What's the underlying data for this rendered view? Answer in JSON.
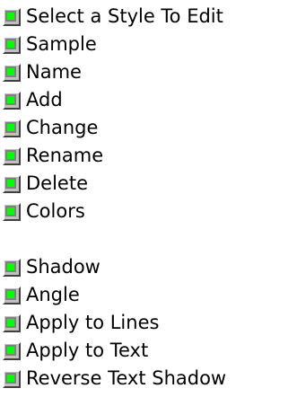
{
  "topics": {
    "group_style": [
      {
        "label": "Select a Style To Edit",
        "icon": "help-topic-icon"
      },
      {
        "label": "Sample",
        "icon": "help-topic-icon"
      },
      {
        "label": "Name",
        "icon": "help-topic-icon"
      },
      {
        "label": "Add",
        "icon": "help-topic-icon"
      },
      {
        "label": "Change",
        "icon": "help-topic-icon"
      },
      {
        "label": "Rename",
        "icon": "help-topic-icon"
      },
      {
        "label": "Delete",
        "icon": "help-topic-icon"
      },
      {
        "label": "Colors",
        "icon": "help-topic-icon"
      }
    ],
    "group_shadow": [
      {
        "label": "Shadow",
        "icon": "help-topic-icon"
      },
      {
        "label": "Angle",
        "icon": "help-topic-icon"
      },
      {
        "label": "Apply to Lines",
        "icon": "help-topic-icon"
      },
      {
        "label": "Apply to Text",
        "icon": "help-topic-icon"
      },
      {
        "label": "Reverse Text Shadow",
        "icon": "help-topic-icon"
      }
    ]
  },
  "colors": {
    "icon_face": "#c0c0c0",
    "icon_indicator": "#00ff00",
    "text": "#000000",
    "background": "#ffffff"
  }
}
